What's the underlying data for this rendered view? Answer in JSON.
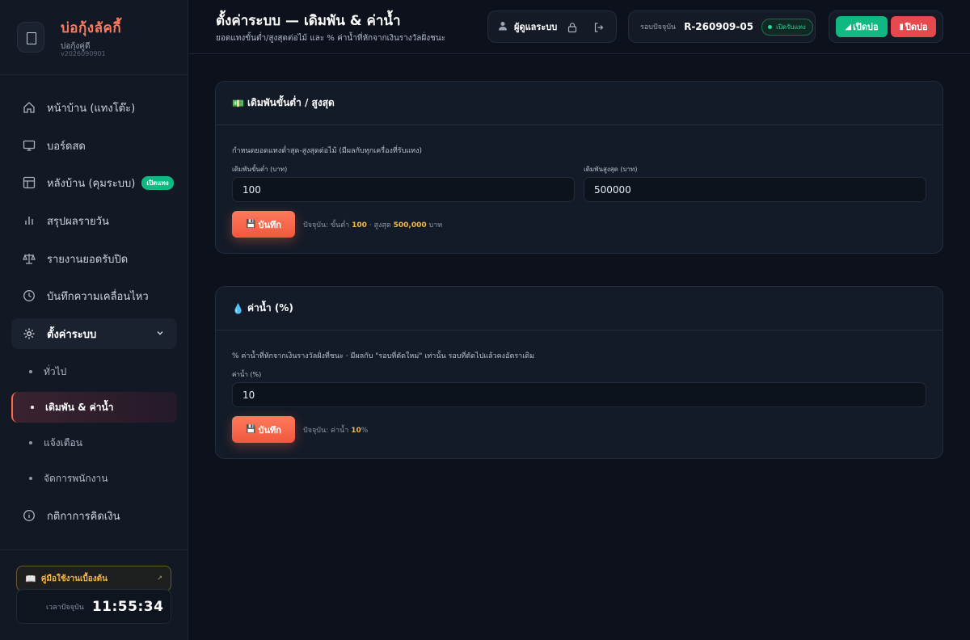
{
  "brand": {
    "name": "บ่อกุ้งลัคกี้",
    "sub": "บ่อกุ้งคู่ดี",
    "version": "v2026090901"
  },
  "nav": {
    "home": "หน้าบ้าน (แทงโต๊ะ)",
    "live": "บอร์ดสด",
    "backend": "หลังบ้าน (คุมระบบ)",
    "backend_badge": "เปิดแทง",
    "daily": "สรุปผลรายวัน",
    "report": "รายงานยอดรับปิด",
    "activity": "บันทึกความเคลื่อนไหว",
    "settings": "ตั้งค่าระบบ",
    "sub": {
      "general": "ทั่วไป",
      "bet": "เดิมพัน & ค่าน้ำ",
      "alert": "แจ้งเตือน",
      "staff": "จัดการพนักงาน"
    },
    "rules": "กติกาการคิดเงิน"
  },
  "guide": {
    "label": "คู่มือใช้งานเบื้องต้น",
    "icon": "📖"
  },
  "clock": {
    "label": "เวลาปัจจุบัน",
    "time": "11:55:34"
  },
  "header": {
    "title": "ตั้งค่าระบบ — เดิมพัน & ค่าน้ำ",
    "subtitle": "ยอดแทงขั้นต่ำ/สูงสุดต่อไม้ และ % ค่าน้ำที่หักจากเงินรางวัลฝั่งชนะ",
    "user": "ผู้ดูแลระบบ",
    "round_label": "รอบปัจจุบัน",
    "round_value": "R-260909-05",
    "round_status": "เปิดรับแทง",
    "open_label": "เปิดบ่อ",
    "close_label": "ปิดบ่อ"
  },
  "bet_card": {
    "icon": "💵",
    "title": "เดิมพันขั้นต่ำ / สูงสุด",
    "desc": "กำหนดยอดแทงต่ำสุด-สูงสุดต่อไม้ (มีผลกับทุกเครื่องที่รับแทง)",
    "min_label": "เดิมพันขั้นต่ำ (บาท)",
    "min_value": "100",
    "max_label": "เดิมพันสูงสุด (บาท)",
    "max_value": "500000",
    "save_label": "บันทึก",
    "current_prefix": "ปัจจุบัน: ขั้นต่ำ",
    "current_min": "100",
    "current_mid": "· สูงสุด",
    "current_max": "500,000",
    "current_suffix": "บาท"
  },
  "fee_card": {
    "icon": "💧",
    "title": "ค่าน้ำ (%)",
    "desc": "% ค่าน้ำที่หักจากเงินรางวัลฝั่งที่ชนะ · มีผลกับ \"รอบที่ตัดใหม่\" เท่านั้น รอบที่ตัดไปแล้วคงอัตราเดิม",
    "fee_label": "ค่าน้ำ (%)",
    "fee_value": "10",
    "save_label": "บันทึก",
    "current_prefix": "ปัจจุบัน: ค่าน้ำ",
    "current_value": "10",
    "current_suffix": "%"
  },
  "colors": {
    "accent": "#ff6b4a",
    "success": "#10b981",
    "danger": "#e5484d",
    "highlight": "#f2b84b"
  }
}
